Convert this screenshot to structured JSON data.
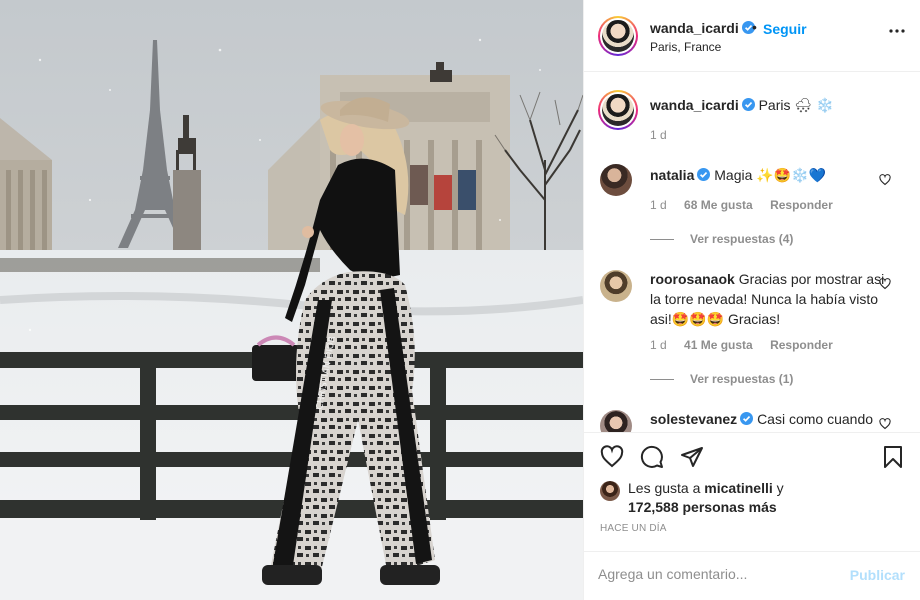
{
  "post": {
    "username": "wanda_icardi",
    "dot": "•",
    "follow_label": "Seguir",
    "location": "Paris, France"
  },
  "caption": {
    "username": "wanda_icardi",
    "text": "Paris 🌨 ❄️",
    "time": "1 d"
  },
  "comments": [
    {
      "username": "natalia",
      "text": "Magia ✨🤩❄️💙",
      "time": "1 d",
      "likes": "68 Me gusta",
      "reply_label": "Responder",
      "view_replies": "Ver respuestas (4)"
    },
    {
      "username": "roorosanaok",
      "text": "Gracias por mostrar asi la torre nevada! Nunca la había visto asi!🤩🤩🤩 Gracias!",
      "time": "1 d",
      "likes": "41 Me gusta",
      "reply_label": "Responder",
      "view_replies": "Ver respuestas (1)"
    },
    {
      "username": "solestevanez",
      "text": "Casi como cuando"
    }
  ],
  "actions": {
    "likes_prefix": "Les gusta a",
    "likes_user": "micatinelli",
    "likes_suffix": "y",
    "likes_count": "172,588 personas más",
    "time_ago": "HACE UN DÍA"
  },
  "add_comment": {
    "placeholder": "Agrega un comentario...",
    "publish_label": "Publicar"
  },
  "colors": {
    "accent": "#0095f6",
    "publish_disabled": "#b2dffc",
    "muted": "#8e8e8e",
    "text": "#262626"
  }
}
